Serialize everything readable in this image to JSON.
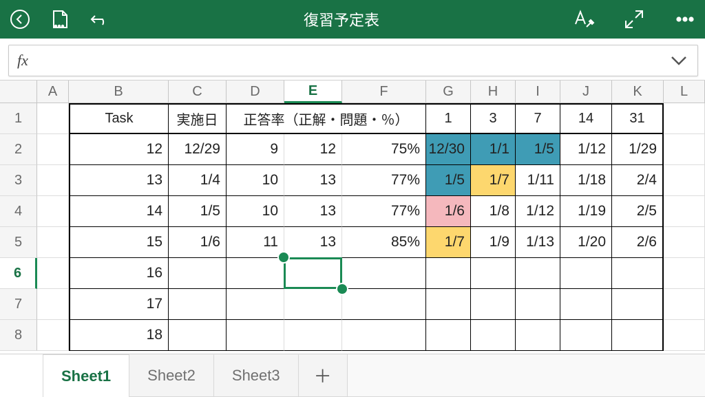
{
  "title": "復習予定表",
  "formula_label": "fx",
  "columns": [
    "A",
    "B",
    "C",
    "D",
    "E",
    "F",
    "G",
    "H",
    "I",
    "J",
    "K",
    "L"
  ],
  "active_column": "E",
  "active_row": 6,
  "header_row": {
    "B": "Task",
    "C": "実施日",
    "DEF": "正答率（正解・問題・％）",
    "G": "1",
    "H": "3",
    "I": "7",
    "J": "14",
    "K": "31"
  },
  "data_rows": [
    {
      "B": "12",
      "C": "12/29",
      "D": "9",
      "E": "12",
      "F": "75%",
      "G": "12/30",
      "H": "1/1",
      "I": "1/5",
      "J": "1/12",
      "K": "1/29",
      "hl": {
        "G": "teal",
        "H": "teal",
        "I": "teal"
      }
    },
    {
      "B": "13",
      "C": "1/4",
      "D": "10",
      "E": "13",
      "F": "77%",
      "G": "1/5",
      "H": "1/7",
      "I": "1/11",
      "J": "1/18",
      "K": "2/4",
      "hl": {
        "G": "teal",
        "H": "yellow"
      }
    },
    {
      "B": "14",
      "C": "1/5",
      "D": "10",
      "E": "13",
      "F": "77%",
      "G": "1/6",
      "H": "1/8",
      "I": "1/12",
      "J": "1/19",
      "K": "2/5",
      "hl": {
        "G": "pink"
      }
    },
    {
      "B": "15",
      "C": "1/6",
      "D": "11",
      "E": "13",
      "F": "85%",
      "G": "1/7",
      "H": "1/9",
      "I": "1/13",
      "J": "1/20",
      "K": "2/6",
      "hl": {
        "G": "yellow"
      }
    },
    {
      "B": "16"
    },
    {
      "B": "17"
    },
    {
      "B": "18"
    }
  ],
  "tabs": [
    "Sheet1",
    "Sheet2",
    "Sheet3"
  ],
  "active_tab": 0
}
